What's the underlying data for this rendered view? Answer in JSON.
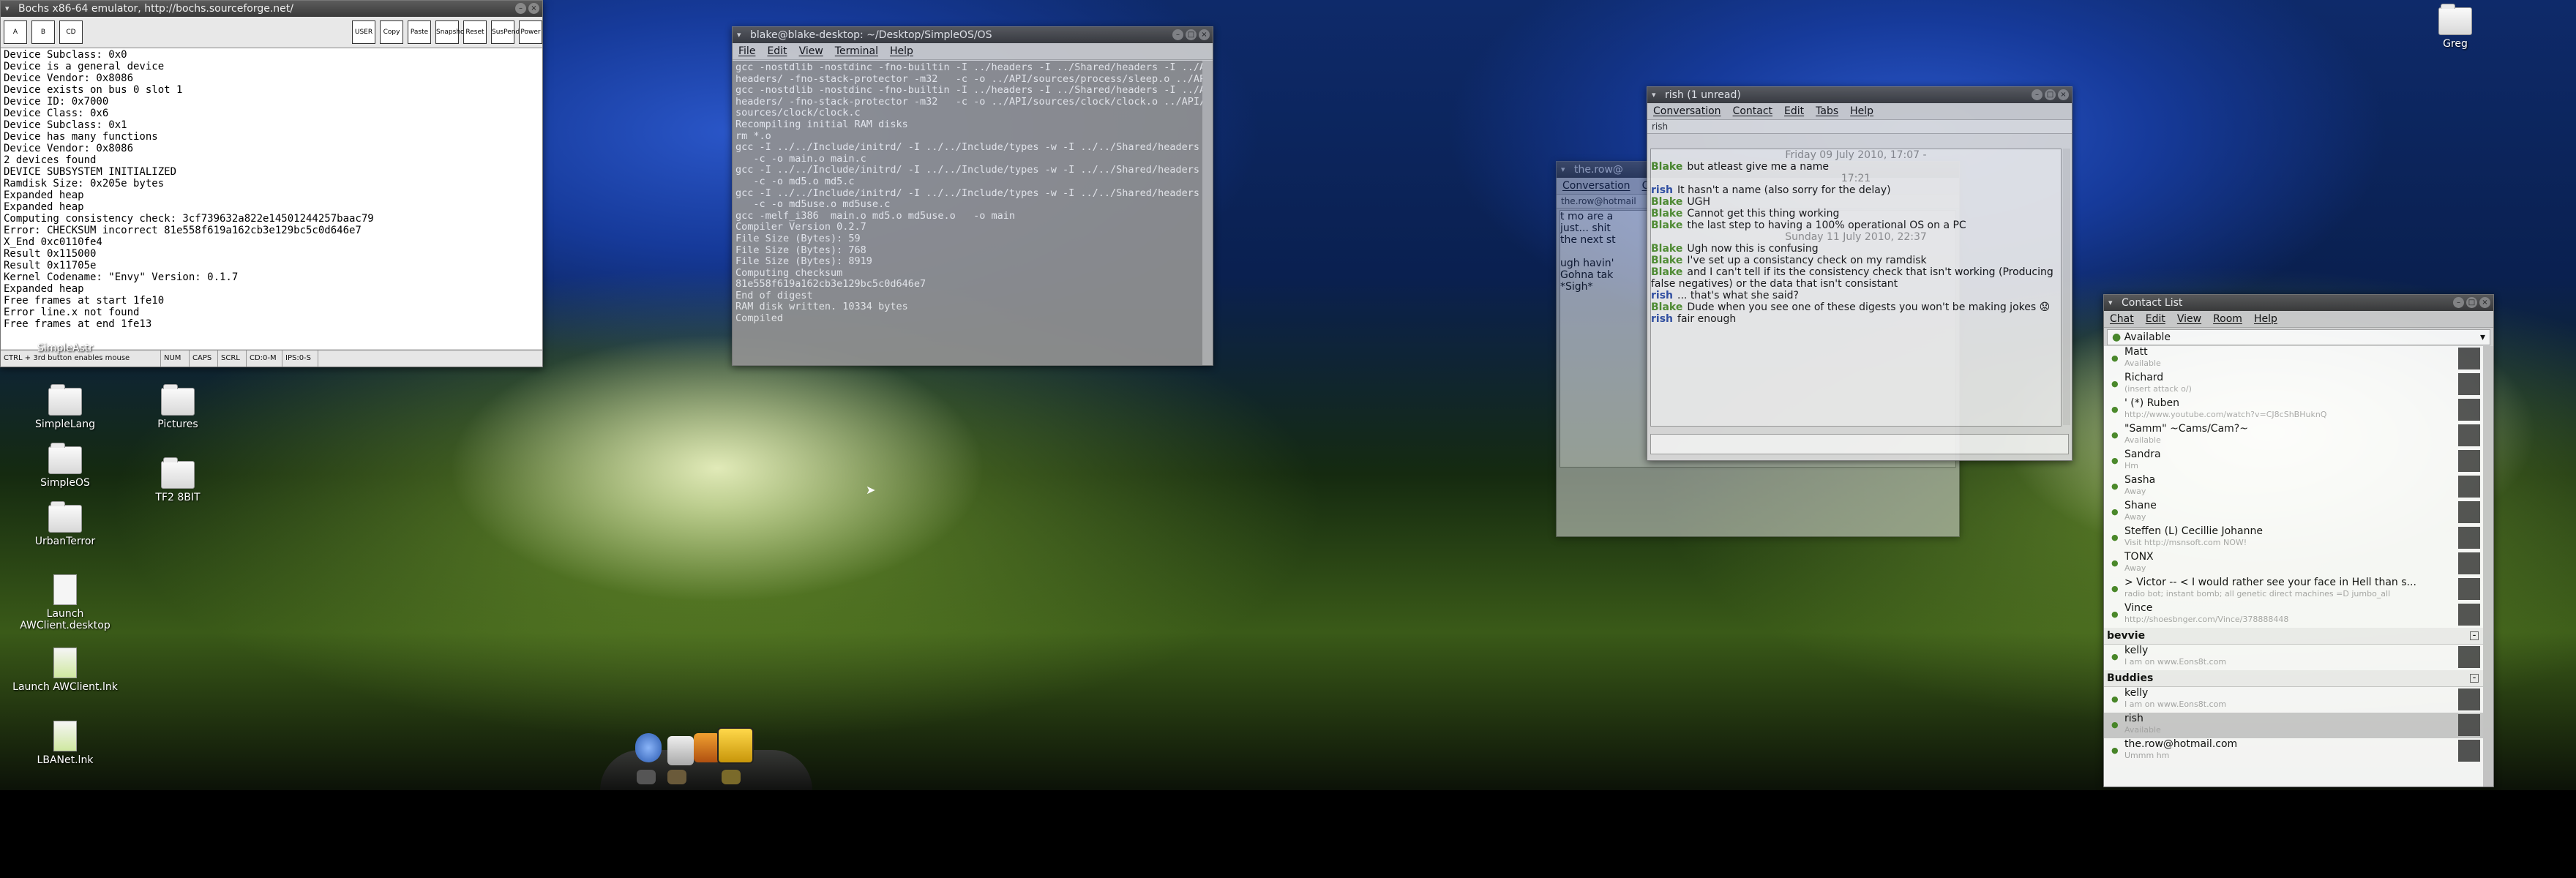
{
  "bochs": {
    "title": "Bochs x86-64 emulator, http://bochs.sourceforge.net/",
    "toolbar": [
      "USER",
      "Copy",
      "Paste",
      "Snapshot",
      "Reset",
      "SusPend",
      "Power"
    ],
    "console": [
      "Device Subclass: 0x0",
      "Device is a general device",
      "Device Vendor: 0x8086",
      "Device exists on bus 0 slot 1",
      "Device ID: 0x7000",
      "Device Class: 0x6",
      "Device Subclass: 0x1",
      "Device has many functions",
      "Device Vendor: 0x8086",
      "2 devices found",
      "DEVICE SUBSYSTEM INITIALIZED",
      "Ramdisk Size: 0x205e bytes",
      "Expanded heap",
      "Expanded heap",
      "Computing consistency check: 3cf739632a822e14501244257baac79",
      "Error: CHECKSUM incorrect 81e558f619a162cb3e129bc5c0d646e7",
      "X_End 0xc0110fe4",
      "Result 0x115000",
      "Result 0x11705e",
      "Kernel Codename: \"Envy\" Version: 0.1.7",
      "Expanded heap",
      "Free frames at start 1fe10",
      "Error line.x not found",
      "Free frames at end 1fe13"
    ],
    "status": [
      "CTRL + 3rd button enables mouse",
      "NUM",
      "CAPS",
      "SCRL",
      "CD:0-M",
      "IPS:0-S"
    ]
  },
  "terminal": {
    "title": "blake@blake-desktop: ~/Desktop/SimpleOS/OS",
    "menu": [
      "File",
      "Edit",
      "View",
      "Terminal",
      "Help"
    ],
    "lines": [
      "gcc -nostdlib -nostdinc -fno-builtin -I ../headers -I ../Shared/headers -I ../API/",
      "headers/ -fno-stack-protector -m32   -c -o ../API/sources/process/sleep.o ../API/sources/process/sleep.c",
      "gcc -nostdlib -nostdinc -fno-builtin -I ../headers -I ../Shared/headers -I ../API/",
      "headers/ -fno-stack-protector -m32   -c -o ../API/sources/clock/clock.o ../API/",
      "sources/clock/clock.c",
      "Recompiling initial RAM disks",
      "rm *.o",
      "gcc -I ../../Include/initrd/ -I ../../Include/types -w -I ../../Shared/headers",
      "   -c -o main.o main.c",
      "gcc -I ../../Include/initrd/ -I ../../Include/types -w -I ../../Shared/headers",
      "   -c -o md5.o md5.c",
      "gcc -I ../../Include/initrd/ -I ../../Include/types -w -I ../../Shared/headers",
      "   -c -o md5use.o md5use.c",
      "gcc -melf_i386  main.o md5.o md5use.o   -o main",
      "Compiler Version 0.2.7",
      "File Size (Bytes): 59",
      "File Size (Bytes): 768",
      "File Size (Bytes): 8919",
      "Computing checksum",
      "81e558f619a162cb3e129bc5c0d646e7",
      "End of digest",
      "RAM disk written. 10334 bytes",
      "Compiled"
    ]
  },
  "desktop": {
    "icons": [
      "SimpleAstr",
      "SimpleLang",
      "Pictures",
      "SimpleOS",
      "TF2 8BIT",
      "UrbanTerror",
      "Launch AWClient.desktop",
      "Launch AWClient.lnk",
      "LBANet.lnk"
    ],
    "right_icon": "Greg"
  },
  "chat_back": {
    "title": "the.row@",
    "menu": [
      "Conversation",
      "C"
    ],
    "tab": "the.row@hotmail",
    "lines": [
      "t mo are a",
      "just... shit",
      "the next st",
      "",
      "ugh havin'",
      "Gohna tak",
      "*Sigh*"
    ]
  },
  "chat": {
    "title": "rish (1 unread)",
    "menu": [
      "Conversation",
      "Contact",
      "Edit",
      "Tabs",
      "Help"
    ],
    "tab": "rish",
    "date1": "Friday 09 July 2010, 17:07 -",
    "time1": "17:21",
    "date2": "Sunday 11 July 2010, 22:37",
    "messages": [
      {
        "n": "Blake",
        "t": "but atleast give me a name"
      },
      {
        "n": "rish",
        "t": "It hasn't a name (also sorry for the delay)"
      },
      {
        "n": "Blake",
        "t": "UGH"
      },
      {
        "n": "Blake",
        "t": "Cannot get this thing working"
      },
      {
        "n": "Blake",
        "t": "the last step to having a 100% operational OS on a PC"
      },
      {
        "n": "Blake",
        "t": "Ugh now this is confusing"
      },
      {
        "n": "Blake",
        "t": "I've set up a consistancy check on my ramdisk"
      },
      {
        "n": "Blake",
        "t": "and I can't tell if its the consistency check that isn't working (Producing false negatives) or the data that isn't consistant"
      },
      {
        "n": "rish",
        "t": "... that's what she said?"
      },
      {
        "n": "Blake",
        "t": "Dude when you see one of these digests you won't be making jokes 😟"
      },
      {
        "n": "rish",
        "t": "fair enough"
      }
    ]
  },
  "contacts": {
    "title": "Contact List",
    "menu": [
      "Chat",
      "Edit",
      "View",
      "Room",
      "Help"
    ],
    "status": "Available",
    "rows": [
      {
        "name": "Matt",
        "sub": "Available"
      },
      {
        "name": "Richard",
        "sub": "(insert attack o/)"
      },
      {
        "name": "'                                       (*) Ruben",
        "sub": "http://www.youtube.com/watch?v=CJ8cShBHuknQ"
      },
      {
        "name": "\"Samm\" ~Cams/Cam?~",
        "sub": "Available"
      },
      {
        "name": "Sandra",
        "sub": "Hm"
      },
      {
        "name": "Sasha",
        "sub": "Away"
      },
      {
        "name": "Shane",
        "sub": "Away"
      },
      {
        "name": "Steffen (L) Cecillie Johanne",
        "sub": "Visit http://msnsoft.com NOW!"
      },
      {
        "name": "TONX",
        "sub": "Away"
      },
      {
        "name": ">     Victor   -- < I would rather see your face in Hell than s...",
        "sub": "radio bot; instant bomb; all genetic direct machines =D jumbo_all"
      },
      {
        "name": "Vince",
        "sub": "http://shoesbnger.com/Vince/378888448"
      }
    ],
    "group1": "bevvie",
    "g1rows": [
      {
        "name": "kelly",
        "sub": "I am on www.Eons8t.com"
      }
    ],
    "group2": "Buddies",
    "g2rows": [
      {
        "name": "kelly",
        "sub": "I am on www.Eons8t.com"
      },
      {
        "name": "rish",
        "sub": "Available"
      },
      {
        "name": "the.row@hotmail.com",
        "sub": "Ummm hm"
      }
    ]
  }
}
